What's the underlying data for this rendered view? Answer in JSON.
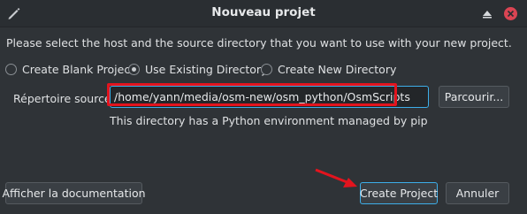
{
  "window": {
    "title": "Nouveau projet",
    "app_icon": "pen-icon",
    "keep_above_icon": "triangle-up-icon",
    "close_icon": "close-icon",
    "close_color": "#da4453"
  },
  "intro_text": "Please select the host and the source directory that you want to use with your new project.",
  "options": {
    "blank": "Create Blank Project",
    "existing": "Use Existing Directory",
    "new_dir": "Create New Directory",
    "selected": "Use Existing Directory"
  },
  "source": {
    "label": "Répertoire source",
    "path": "/home/yann/media/osm-new/osm_python/OsmScripts",
    "browse_label": "Parcourir...",
    "note": "This directory has a Python environment managed by pip"
  },
  "buttons": {
    "docs": "Afficher la documentation",
    "create": "Create Project",
    "cancel": "Annuler"
  },
  "colors": {
    "accent": "#3daee9",
    "annotation": "#e3141e"
  }
}
